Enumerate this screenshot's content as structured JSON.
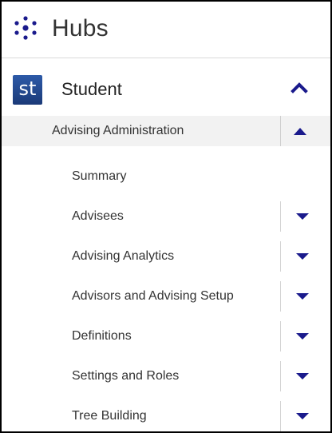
{
  "hubs": {
    "title": "Hubs",
    "icon": "hub-network-icon"
  },
  "student": {
    "logo_text": "st",
    "label": "Student",
    "expanded": true
  },
  "advising_admin": {
    "label": "Advising Administration",
    "expanded": true
  },
  "menu_items": [
    {
      "label": "Summary",
      "has_submenu": false
    },
    {
      "label": "Advisees",
      "has_submenu": true
    },
    {
      "label": "Advising Analytics",
      "has_submenu": true
    },
    {
      "label": "Advisors and Advising Setup",
      "has_submenu": true
    },
    {
      "label": "Definitions",
      "has_submenu": true
    },
    {
      "label": "Settings and Roles",
      "has_submenu": true
    },
    {
      "label": "Tree Building",
      "has_submenu": true
    }
  ],
  "colors": {
    "accent": "#1a1a8c",
    "logo_bg": "#1f3f7e",
    "active_row_bg": "#f2f2f2",
    "divider": "#d4d4d4"
  }
}
